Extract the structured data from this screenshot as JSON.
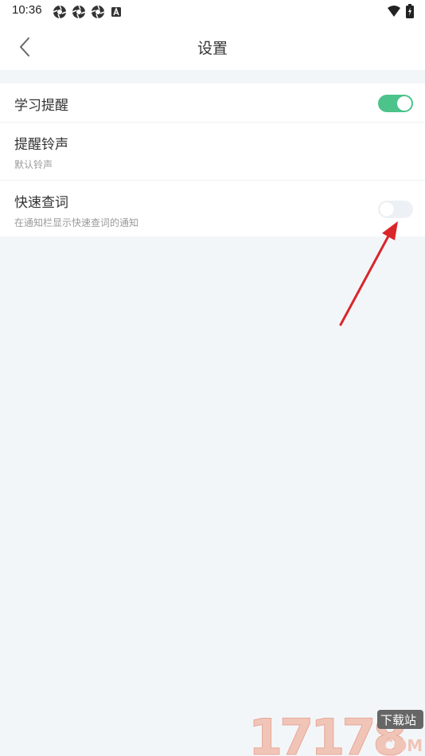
{
  "status_bar": {
    "time": "10:36",
    "notification_icons": [
      "aperture-icon",
      "aperture-icon",
      "aperture-icon",
      "a-badge-icon"
    ],
    "right_icons": [
      "wifi-icon",
      "battery-charging-icon"
    ]
  },
  "header": {
    "title": "设置",
    "back_icon": "chevron-left-icon"
  },
  "settings": {
    "items": [
      {
        "title": "学习提醒",
        "subtitle": "",
        "toggle_state": "on"
      },
      {
        "title": "提醒铃声",
        "subtitle": "默认铃声"
      },
      {
        "title": "快速查词",
        "subtitle": "在通知栏显示快速查词的通知",
        "toggle_state": "off"
      }
    ]
  },
  "colors": {
    "toggle_on": "#4cc38a",
    "toggle_off": "#edf1f5",
    "page_background": "#f3f6f9",
    "annotation_arrow": "#d9262a"
  },
  "watermark": {
    "text": "17178",
    "badge": "下载站",
    "domain": ".COM"
  }
}
